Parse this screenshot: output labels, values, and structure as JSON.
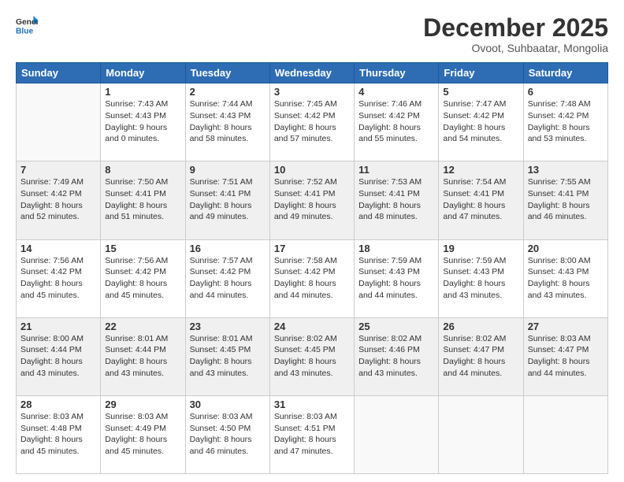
{
  "header": {
    "logo_line1": "General",
    "logo_line2": "Blue",
    "title": "December 2025",
    "subtitle": "Ovoot, Suhbaatar, Mongolia"
  },
  "columns": [
    "Sunday",
    "Monday",
    "Tuesday",
    "Wednesday",
    "Thursday",
    "Friday",
    "Saturday"
  ],
  "weeks": [
    [
      {
        "day": "",
        "sunrise": "",
        "sunset": "",
        "daylight": ""
      },
      {
        "day": "1",
        "sunrise": "Sunrise: 7:43 AM",
        "sunset": "Sunset: 4:43 PM",
        "daylight": "Daylight: 9 hours and 0 minutes."
      },
      {
        "day": "2",
        "sunrise": "Sunrise: 7:44 AM",
        "sunset": "Sunset: 4:43 PM",
        "daylight": "Daylight: 8 hours and 58 minutes."
      },
      {
        "day": "3",
        "sunrise": "Sunrise: 7:45 AM",
        "sunset": "Sunset: 4:42 PM",
        "daylight": "Daylight: 8 hours and 57 minutes."
      },
      {
        "day": "4",
        "sunrise": "Sunrise: 7:46 AM",
        "sunset": "Sunset: 4:42 PM",
        "daylight": "Daylight: 8 hours and 55 minutes."
      },
      {
        "day": "5",
        "sunrise": "Sunrise: 7:47 AM",
        "sunset": "Sunset: 4:42 PM",
        "daylight": "Daylight: 8 hours and 54 minutes."
      },
      {
        "day": "6",
        "sunrise": "Sunrise: 7:48 AM",
        "sunset": "Sunset: 4:42 PM",
        "daylight": "Daylight: 8 hours and 53 minutes."
      }
    ],
    [
      {
        "day": "7",
        "sunrise": "Sunrise: 7:49 AM",
        "sunset": "Sunset: 4:42 PM",
        "daylight": "Daylight: 8 hours and 52 minutes."
      },
      {
        "day": "8",
        "sunrise": "Sunrise: 7:50 AM",
        "sunset": "Sunset: 4:41 PM",
        "daylight": "Daylight: 8 hours and 51 minutes."
      },
      {
        "day": "9",
        "sunrise": "Sunrise: 7:51 AM",
        "sunset": "Sunset: 4:41 PM",
        "daylight": "Daylight: 8 hours and 49 minutes."
      },
      {
        "day": "10",
        "sunrise": "Sunrise: 7:52 AM",
        "sunset": "Sunset: 4:41 PM",
        "daylight": "Daylight: 8 hours and 49 minutes."
      },
      {
        "day": "11",
        "sunrise": "Sunrise: 7:53 AM",
        "sunset": "Sunset: 4:41 PM",
        "daylight": "Daylight: 8 hours and 48 minutes."
      },
      {
        "day": "12",
        "sunrise": "Sunrise: 7:54 AM",
        "sunset": "Sunset: 4:41 PM",
        "daylight": "Daylight: 8 hours and 47 minutes."
      },
      {
        "day": "13",
        "sunrise": "Sunrise: 7:55 AM",
        "sunset": "Sunset: 4:41 PM",
        "daylight": "Daylight: 8 hours and 46 minutes."
      }
    ],
    [
      {
        "day": "14",
        "sunrise": "Sunrise: 7:56 AM",
        "sunset": "Sunset: 4:42 PM",
        "daylight": "Daylight: 8 hours and 45 minutes."
      },
      {
        "day": "15",
        "sunrise": "Sunrise: 7:56 AM",
        "sunset": "Sunset: 4:42 PM",
        "daylight": "Daylight: 8 hours and 45 minutes."
      },
      {
        "day": "16",
        "sunrise": "Sunrise: 7:57 AM",
        "sunset": "Sunset: 4:42 PM",
        "daylight": "Daylight: 8 hours and 44 minutes."
      },
      {
        "day": "17",
        "sunrise": "Sunrise: 7:58 AM",
        "sunset": "Sunset: 4:42 PM",
        "daylight": "Daylight: 8 hours and 44 minutes."
      },
      {
        "day": "18",
        "sunrise": "Sunrise: 7:59 AM",
        "sunset": "Sunset: 4:43 PM",
        "daylight": "Daylight: 8 hours and 44 minutes."
      },
      {
        "day": "19",
        "sunrise": "Sunrise: 7:59 AM",
        "sunset": "Sunset: 4:43 PM",
        "daylight": "Daylight: 8 hours and 43 minutes."
      },
      {
        "day": "20",
        "sunrise": "Sunrise: 8:00 AM",
        "sunset": "Sunset: 4:43 PM",
        "daylight": "Daylight: 8 hours and 43 minutes."
      }
    ],
    [
      {
        "day": "21",
        "sunrise": "Sunrise: 8:00 AM",
        "sunset": "Sunset: 4:44 PM",
        "daylight": "Daylight: 8 hours and 43 minutes."
      },
      {
        "day": "22",
        "sunrise": "Sunrise: 8:01 AM",
        "sunset": "Sunset: 4:44 PM",
        "daylight": "Daylight: 8 hours and 43 minutes."
      },
      {
        "day": "23",
        "sunrise": "Sunrise: 8:01 AM",
        "sunset": "Sunset: 4:45 PM",
        "daylight": "Daylight: 8 hours and 43 minutes."
      },
      {
        "day": "24",
        "sunrise": "Sunrise: 8:02 AM",
        "sunset": "Sunset: 4:45 PM",
        "daylight": "Daylight: 8 hours and 43 minutes."
      },
      {
        "day": "25",
        "sunrise": "Sunrise: 8:02 AM",
        "sunset": "Sunset: 4:46 PM",
        "daylight": "Daylight: 8 hours and 43 minutes."
      },
      {
        "day": "26",
        "sunrise": "Sunrise: 8:02 AM",
        "sunset": "Sunset: 4:47 PM",
        "daylight": "Daylight: 8 hours and 44 minutes."
      },
      {
        "day": "27",
        "sunrise": "Sunrise: 8:03 AM",
        "sunset": "Sunset: 4:47 PM",
        "daylight": "Daylight: 8 hours and 44 minutes."
      }
    ],
    [
      {
        "day": "28",
        "sunrise": "Sunrise: 8:03 AM",
        "sunset": "Sunset: 4:48 PM",
        "daylight": "Daylight: 8 hours and 45 minutes."
      },
      {
        "day": "29",
        "sunrise": "Sunrise: 8:03 AM",
        "sunset": "Sunset: 4:49 PM",
        "daylight": "Daylight: 8 hours and 45 minutes."
      },
      {
        "day": "30",
        "sunrise": "Sunrise: 8:03 AM",
        "sunset": "Sunset: 4:50 PM",
        "daylight": "Daylight: 8 hours and 46 minutes."
      },
      {
        "day": "31",
        "sunrise": "Sunrise: 8:03 AM",
        "sunset": "Sunset: 4:51 PM",
        "daylight": "Daylight: 8 hours and 47 minutes."
      },
      {
        "day": "",
        "sunrise": "",
        "sunset": "",
        "daylight": ""
      },
      {
        "day": "",
        "sunrise": "",
        "sunset": "",
        "daylight": ""
      },
      {
        "day": "",
        "sunrise": "",
        "sunset": "",
        "daylight": ""
      }
    ]
  ]
}
